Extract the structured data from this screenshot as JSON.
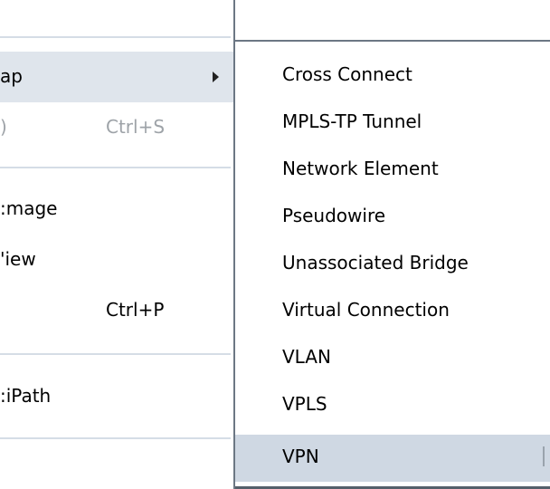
{
  "main_menu": {
    "items": [
      {
        "label": "ap",
        "shortcut": "",
        "has_submenu": true,
        "highlighted": true,
        "disabled": false
      },
      {
        "label": ")",
        "shortcut": "Ctrl+S",
        "has_submenu": false,
        "highlighted": false,
        "disabled": true
      },
      {
        "label": ":mage",
        "shortcut": "",
        "has_submenu": false,
        "highlighted": false,
        "disabled": false
      },
      {
        "label": "'iew",
        "shortcut": "",
        "has_submenu": false,
        "highlighted": false,
        "disabled": false
      },
      {
        "label": "",
        "shortcut": "Ctrl+P",
        "has_submenu": false,
        "highlighted": false,
        "disabled": false
      },
      {
        "label": ":iPath",
        "shortcut": "",
        "has_submenu": false,
        "highlighted": false,
        "disabled": false
      }
    ]
  },
  "submenu": {
    "items": [
      {
        "label": "Cross Connect"
      },
      {
        "label": "MPLS-TP Tunnel"
      },
      {
        "label": "Network Element"
      },
      {
        "label": "Pseudowire"
      },
      {
        "label": "Unassociated Bridge"
      },
      {
        "label": "Virtual Connection"
      },
      {
        "label": "VLAN"
      },
      {
        "label": "VPLS"
      },
      {
        "label": "VPN",
        "highlighted": true
      }
    ]
  },
  "colors": {
    "highlight": "#dfe5ec",
    "submenu_highlight": "#cfd8e3",
    "separator": "#d5dde6",
    "disabled_text": "#9ea3a8"
  }
}
